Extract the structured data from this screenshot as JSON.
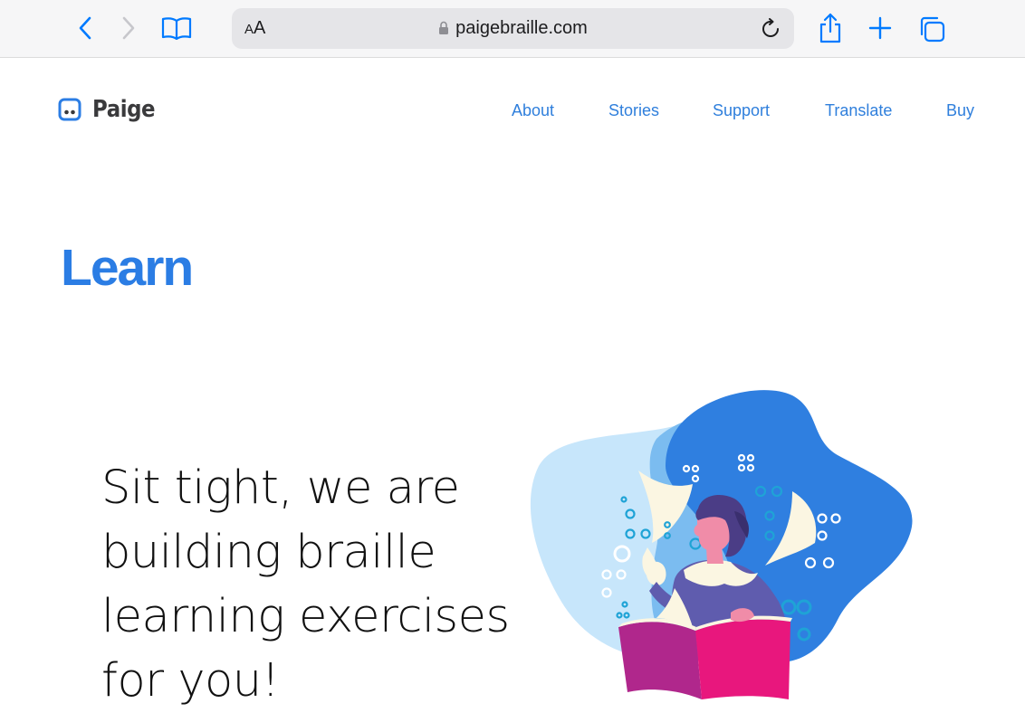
{
  "browser": {
    "aa_small": "A",
    "aa_big": "A",
    "url": "paigebraille.com",
    "icons": {
      "back": "chevron-left-icon",
      "forward": "chevron-right-icon",
      "bookmarks": "open-book-icon",
      "lock": "lock-icon",
      "reload": "reload-icon",
      "share": "share-icon",
      "new_tab": "plus-icon",
      "tabs": "tabs-icon"
    },
    "accent_color": "#007aff"
  },
  "site": {
    "logo_text": "Paige",
    "nav": [
      "About",
      "Stories",
      "Support",
      "Translate",
      "Buy"
    ],
    "link_color": "#2f7fdc"
  },
  "main": {
    "title": "Learn",
    "hero": "Sit tight, we are building braille learning exercises for you!",
    "title_color": "#2b7de4"
  }
}
